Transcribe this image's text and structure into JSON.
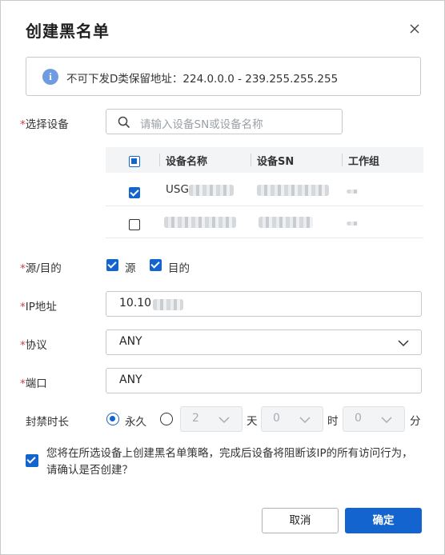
{
  "dialog": {
    "title": "创建黑名单",
    "info": "不可下发D类保留地址：224.0.0.0 - 239.255.255.255"
  },
  "device": {
    "label": "选择设备",
    "required_mark": "*",
    "search_placeholder": "请输入设备SN或设备名称",
    "columns": [
      "设备名称",
      "设备SN",
      "工作组"
    ],
    "rows": [
      {
        "name": "USG",
        "sn": "",
        "group": "",
        "checked": true
      },
      {
        "name": "",
        "sn": "",
        "group": "",
        "checked": false
      }
    ]
  },
  "direction": {
    "label": "源/目的",
    "required_mark": "*",
    "source_label": "源",
    "dest_label": "目的",
    "source_checked": true,
    "dest_checked": true
  },
  "ip": {
    "label": "IP地址",
    "required_mark": "*",
    "value": "10.10"
  },
  "protocol": {
    "label": "协议",
    "required_mark": "*",
    "value": "ANY"
  },
  "port": {
    "label": "端口",
    "required_mark": "*",
    "value": "ANY"
  },
  "duration": {
    "label": "封禁时长",
    "permanent_label": "永久",
    "permanent_selected": true,
    "days": "2",
    "days_unit": "天",
    "hours": "0",
    "hours_unit": "时",
    "minutes": "0",
    "minutes_unit": "分"
  },
  "confirm": {
    "text": "您将在所选设备上创建黑名单策略，完成后设备将阻断该IP的所有访问行为，请确认是否创建？",
    "checked": true
  },
  "buttons": {
    "cancel": "取消",
    "ok": "确定"
  },
  "colors": {
    "primary": "#1464cf",
    "required": "#e0393e",
    "info_icon": "#6f9be0"
  }
}
